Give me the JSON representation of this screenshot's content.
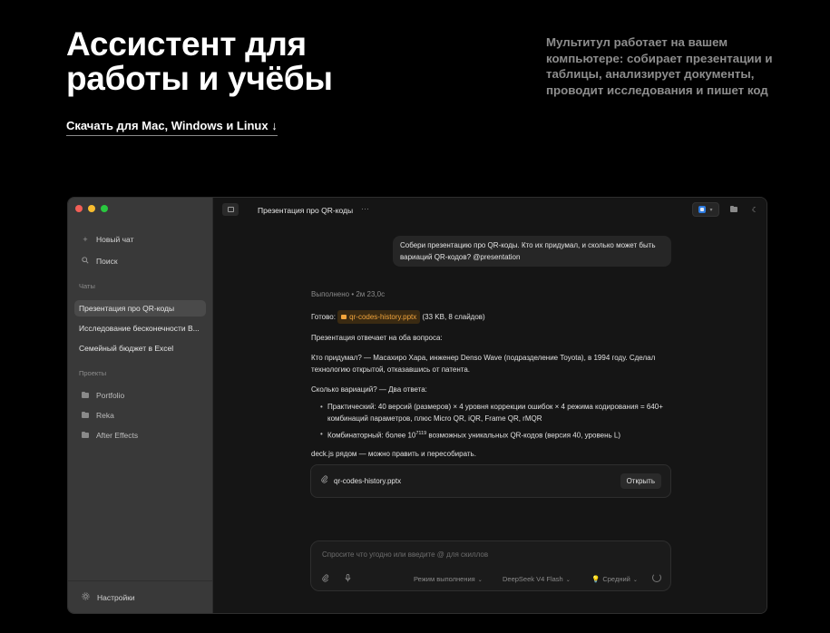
{
  "hero": {
    "title": "Ассистент для работы и учёбы",
    "download": "Скачать для Mac, Windows и Linux ↓",
    "description": "Мультитул работает на вашем компьютере: собирает презентации и таблицы, анализирует документы, проводит исследования и пишет код"
  },
  "sidebar": {
    "new_chat": "Новый чат",
    "search": "Поиск",
    "chats_label": "Чаты",
    "chats": [
      "Презентация про QR-коды",
      "Исследование бесконечности В...",
      "Семейный бюджет в Excel"
    ],
    "projects_label": "Проекты",
    "projects": [
      "Portfolio",
      "Reka",
      "After Effects"
    ],
    "settings": "Настройки"
  },
  "topbar": {
    "title": "Презентация про QR-коды",
    "more": "···"
  },
  "conversation": {
    "user_message": "Собери презентацию про QR-коды. Кто их придумал, и сколько может быть вариаций QR-кодов? @presentation",
    "meta": "Выполнено • 2м 23,0с",
    "ready_prefix": "Готово:",
    "ready_file": "qr-codes-history.pptx",
    "ready_suffix": "(33 KB, 8 слайдов)",
    "intro": "Презентация отвечает на оба вопроса:",
    "who": "Кто придумал? — Масахиро Хара, инженер Denso Wave (подразделение Toyota), в 1994 году. Сделал технологию открытой, отказавшись от патента.",
    "how_many": "Сколько вариаций? — Два ответа:",
    "bullet1": "Практический: 40 версий (размеров) × 4 уровня коррекции ошибок × 4 режима кодирования = 640+ комбинаций параметров, плюс Micro QR, iQR, Frame QR, rMQR",
    "bullet2_pre": "Комбинаторный: более 10",
    "bullet2_sup": "7119",
    "bullet2_post": " возможных уникальных QR-кодов (версия 40, уровень L)",
    "deck": "deck.js рядом — можно править и пересобирать."
  },
  "file_card": {
    "name": "qr-codes-history.pptx",
    "open": "Открыть"
  },
  "composer": {
    "placeholder": "Спросите что угодно или введите @ для скиллов",
    "mode": "Режим выполнения",
    "model": "DeepSeek V4 Flash",
    "level": "Средний"
  },
  "icons": {
    "new_chat": "plus-icon",
    "search": "search-icon",
    "settings": "gear-icon",
    "attach": "paperclip-icon",
    "mic": "microphone-icon"
  },
  "colors": {
    "accent_file": "#f3a53c",
    "sidebar_bg": "#393939",
    "main_bg": "#151515"
  }
}
